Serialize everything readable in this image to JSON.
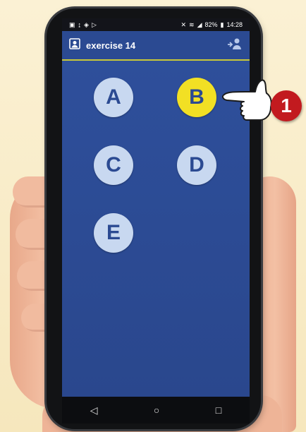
{
  "statusbar": {
    "battery": "82%",
    "time": "14:28"
  },
  "appbar": {
    "title": "exercise 14"
  },
  "choices": [
    "A",
    "B",
    "C",
    "D",
    "E"
  ],
  "selected_choice": "B",
  "step_badge": "1",
  "colors": {
    "app_background": "#2d4e98",
    "choice_default": "#c8d8f0",
    "choice_selected": "#f2e024",
    "appbar_underline": "#c8c838",
    "step_badge": "#c21a1f"
  },
  "icons": [
    "profile-icon",
    "share-user-icon",
    "back-nav-icon",
    "home-nav-icon",
    "recents-nav-icon",
    "pointing-hand-icon"
  ]
}
